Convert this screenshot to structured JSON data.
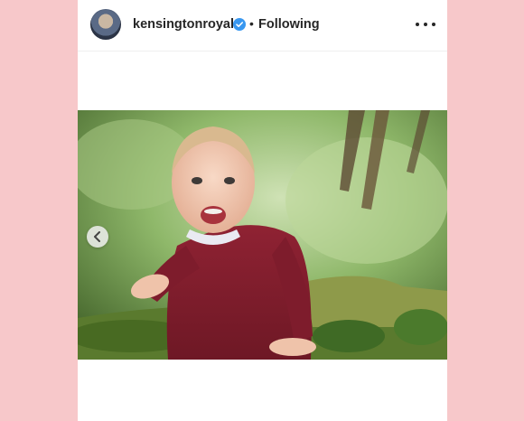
{
  "post": {
    "username": "kensingtonroyal",
    "separator": "•",
    "follow_status": "Following",
    "icons": {
      "avatar": "profile-avatar",
      "verified": "verified-badge-icon",
      "more": "more-options-icon",
      "prev": "chevron-left-icon"
    },
    "colors": {
      "background": "#f7c8ca",
      "verified": "#3897f0",
      "text": "#262626"
    }
  }
}
